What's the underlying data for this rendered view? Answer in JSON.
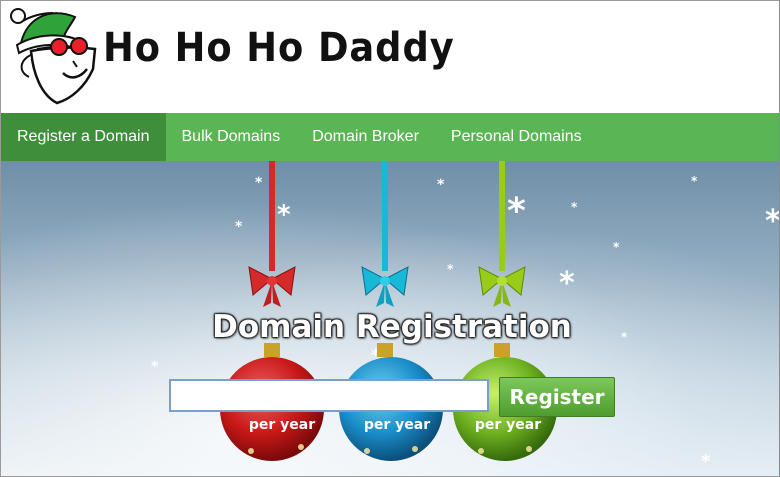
{
  "header": {
    "brand_name": "Ho Ho Ho Daddy",
    "logo_icon": "elf-mascot-icon"
  },
  "nav": {
    "items": [
      {
        "label": "Register a Domain",
        "active": true
      },
      {
        "label": "Bulk Domains",
        "active": false
      },
      {
        "label": "Domain Broker",
        "active": false
      },
      {
        "label": "Personal Domains",
        "active": false
      }
    ],
    "active_color": "#3e8e3c",
    "bar_color": "#5ab655"
  },
  "hero": {
    "title": "Domain Registration",
    "search": {
      "value": "",
      "placeholder": ""
    },
    "register_label": "Register",
    "ornaments": [
      {
        "color": "red",
        "ribbon_color": "#d42a2a",
        "price_text": "per year"
      },
      {
        "color": "blue",
        "ribbon_color": "#18b8d8",
        "price_text": "per year"
      },
      {
        "color": "green",
        "ribbon_color": "#98cc1a",
        "price_text": "per year"
      }
    ]
  }
}
